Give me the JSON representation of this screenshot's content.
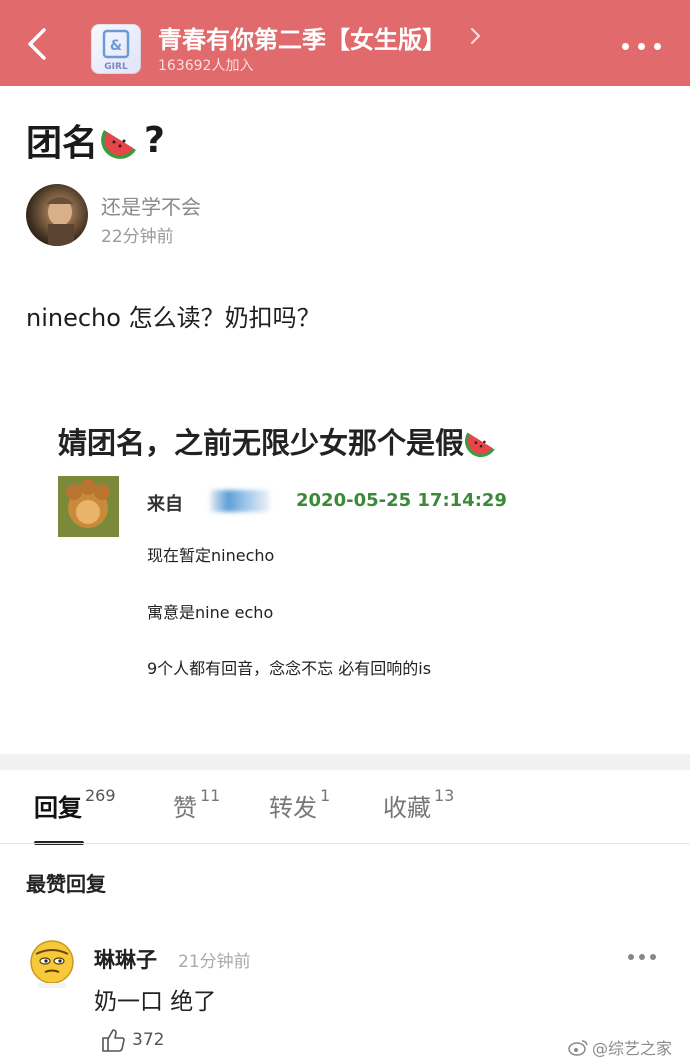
{
  "header": {
    "group_title": "青春有你第二季【女生版】",
    "members": "163692人加入",
    "logo_text": "GIRL",
    "colors": {
      "bar": "#e06a6c",
      "text": "#ffffff"
    }
  },
  "post": {
    "title": "团名",
    "title_suffix": "?",
    "title_emoji": "watermelon-emoji",
    "author": "还是学不会",
    "time": "22分钟前",
    "body": "ninecho 怎么读？奶扣吗？"
  },
  "screenshot": {
    "title": "婧团名，之前无限少女那个是假",
    "from_label": "来自",
    "date": "2020-05-25 17:14:29",
    "lines": [
      "现在暂定ninecho",
      "寓意是nine echo",
      "9个人都有回音，念念不忘 必有回响的is"
    ]
  },
  "tabs": [
    {
      "label": "回复",
      "count": "269"
    },
    {
      "label": "赞",
      "count": "11"
    },
    {
      "label": "转发",
      "count": "1"
    },
    {
      "label": "收藏",
      "count": "13"
    }
  ],
  "replies_section": {
    "label": "最赞回复"
  },
  "reply": {
    "name": "琳琳子",
    "time": "21分钟前",
    "text": "奶一口 绝了",
    "likes": "372"
  },
  "watermark": {
    "text": "@综艺之家"
  }
}
